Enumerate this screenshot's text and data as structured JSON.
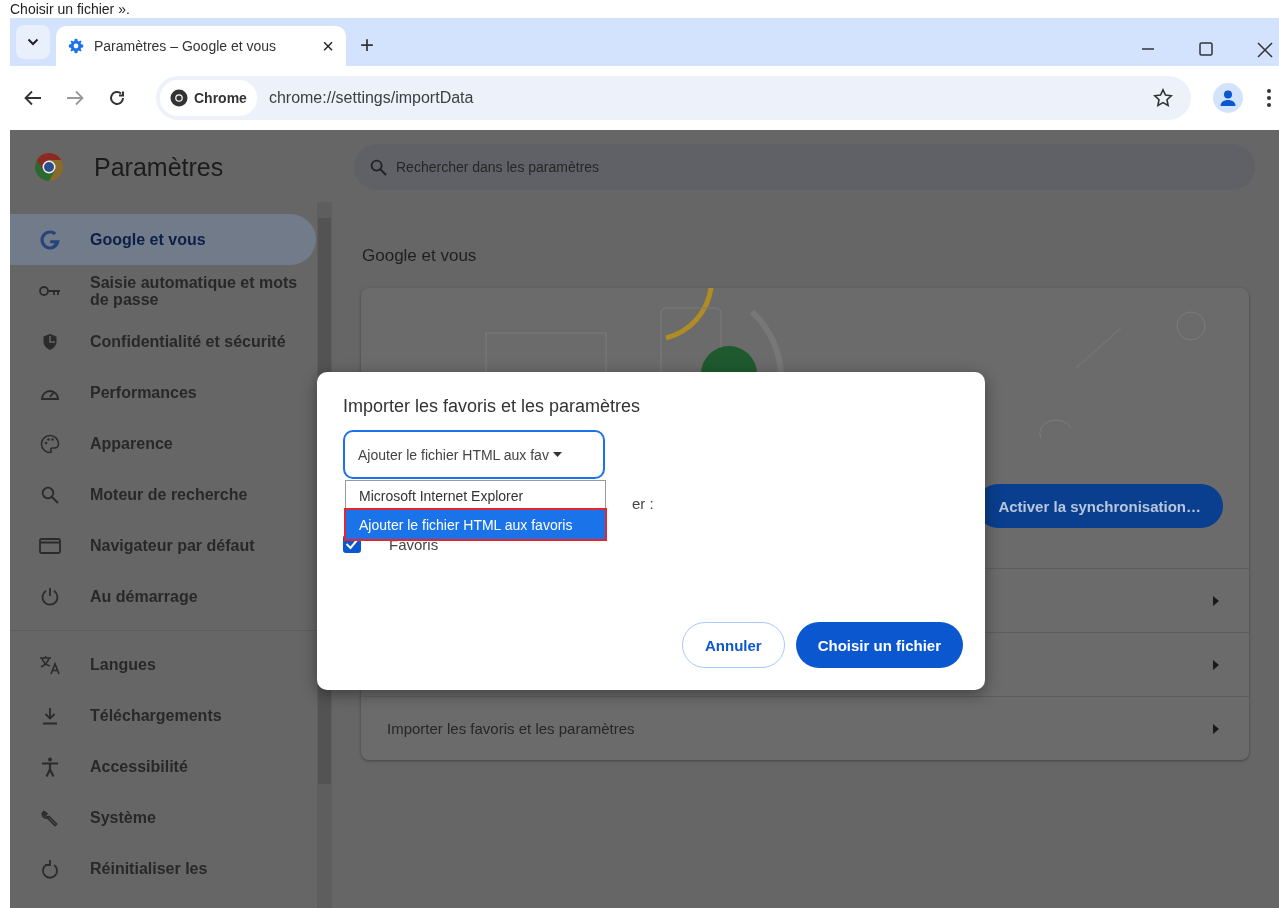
{
  "caption": "Choisir un fichier ».",
  "tabs": [
    {
      "title": "Paramètres – Google et vous",
      "selected": true,
      "close": "×"
    }
  ],
  "new_tab": "+",
  "toolbar": {
    "chip": "Chrome",
    "url": "chrome://settings/importData"
  },
  "sidebar": {
    "title": "Paramètres",
    "groups": [
      {
        "items": [
          {
            "label": "Google et vous",
            "selected": true
          },
          {
            "label": "Saisie automatique et mots de passe",
            "selected": false
          },
          {
            "label": "Confidentialité et sécurité",
            "selected": false
          },
          {
            "label": "Performances",
            "selected": false
          },
          {
            "label": "Apparence",
            "selected": false
          },
          {
            "label": "Moteur de recherche",
            "selected": false
          },
          {
            "label": "Navigateur par défaut",
            "selected": false
          },
          {
            "label": "Au démarrage",
            "selected": false
          }
        ]
      },
      {
        "items": [
          {
            "label": "Langues",
            "selected": false
          },
          {
            "label": "Téléchargements",
            "selected": false
          },
          {
            "label": "Accessibilité",
            "selected": false
          },
          {
            "label": "Système",
            "selected": false
          },
          {
            "label": "Réinitialiser les",
            "selected": false
          }
        ]
      }
    ]
  },
  "search": {
    "placeholder": "Rechercher dans les paramètres"
  },
  "section_title": "Google et vous",
  "card": {
    "sync_button": "Activer la synchronisation…",
    "rows": [
      {
        "kind": "covered"
      },
      {
        "kind": "covered"
      },
      {
        "kind": "link",
        "label": "Importer les favoris et les paramètres"
      }
    ]
  },
  "dialog": {
    "title": "Importer les favoris et les paramètres",
    "select_value": "Ajouter le fichier HTML aux fav",
    "options": [
      {
        "label": "Microsoft Internet Explorer",
        "selected": false,
        "annotated": false
      },
      {
        "label": "Ajouter le fichier HTML aux favoris",
        "selected": true,
        "annotated": true
      }
    ],
    "items_label": "er :",
    "checkboxes": [
      {
        "label": "Favoris",
        "checked": true
      }
    ],
    "buttons": [
      {
        "label": "Annuler",
        "kind": "secondary"
      },
      {
        "label": "Choisir un fichier",
        "kind": "primary"
      }
    ]
  }
}
